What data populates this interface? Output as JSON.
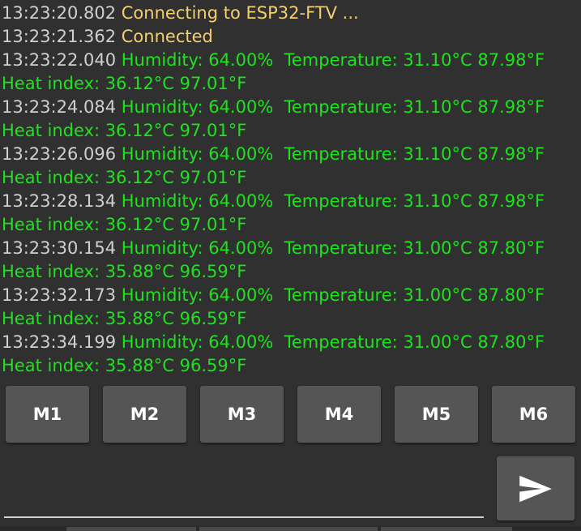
{
  "colors": {
    "background": "#303030",
    "timestamp": "#cfcfcf",
    "status_text": "#f5cf6a",
    "data_text": "#1ee21e",
    "button": "#555555",
    "button_text": "#ffffff"
  },
  "log": [
    {
      "ts": "13:23:20.802",
      "text": "Connecting to ESP32-FTV ...",
      "kind": "status"
    },
    {
      "ts": "13:23:21.362",
      "text": "Connected",
      "kind": "status"
    },
    {
      "ts": "13:23:22.040",
      "text": "Humidity: 64.00%  Temperature: 31.10°C 87.98°F",
      "kind": "data"
    },
    {
      "ts": "",
      "text": "Heat index: 36.12°C 97.01°F",
      "kind": "data"
    },
    {
      "ts": "13:23:24.084",
      "text": "Humidity: 64.00%  Temperature: 31.10°C 87.98°F",
      "kind": "data"
    },
    {
      "ts": "",
      "text": "Heat index: 36.12°C 97.01°F",
      "kind": "data"
    },
    {
      "ts": "13:23:26.096",
      "text": "Humidity: 64.00%  Temperature: 31.10°C 87.98°F",
      "kind": "data"
    },
    {
      "ts": "",
      "text": "Heat index: 36.12°C 97.01°F",
      "kind": "data"
    },
    {
      "ts": "13:23:28.134",
      "text": "Humidity: 64.00%  Temperature: 31.10°C 87.98°F",
      "kind": "data"
    },
    {
      "ts": "",
      "text": "Heat index: 36.12°C 97.01°F",
      "kind": "data"
    },
    {
      "ts": "13:23:30.154",
      "text": "Humidity: 64.00%  Temperature: 31.00°C 87.80°F",
      "kind": "data"
    },
    {
      "ts": "",
      "text": "Heat index: 35.88°C 96.59°F",
      "kind": "data"
    },
    {
      "ts": "13:23:32.173",
      "text": "Humidity: 64.00%  Temperature: 31.00°C 87.80°F",
      "kind": "data"
    },
    {
      "ts": "",
      "text": "Heat index: 35.88°C 96.59°F",
      "kind": "data"
    },
    {
      "ts": "13:23:34.199",
      "text": "Humidity: 64.00%  Temperature: 31.00°C 87.80°F",
      "kind": "data"
    },
    {
      "ts": "",
      "text": "Heat index: 35.88°C 96.59°F",
      "kind": "data"
    }
  ],
  "macros": [
    {
      "label": "M1"
    },
    {
      "label": "M2"
    },
    {
      "label": "M3"
    },
    {
      "label": "M4"
    },
    {
      "label": "M5"
    },
    {
      "label": "M6"
    }
  ],
  "input": {
    "value": "",
    "placeholder": ""
  },
  "send_button": {
    "icon": "send-icon"
  }
}
